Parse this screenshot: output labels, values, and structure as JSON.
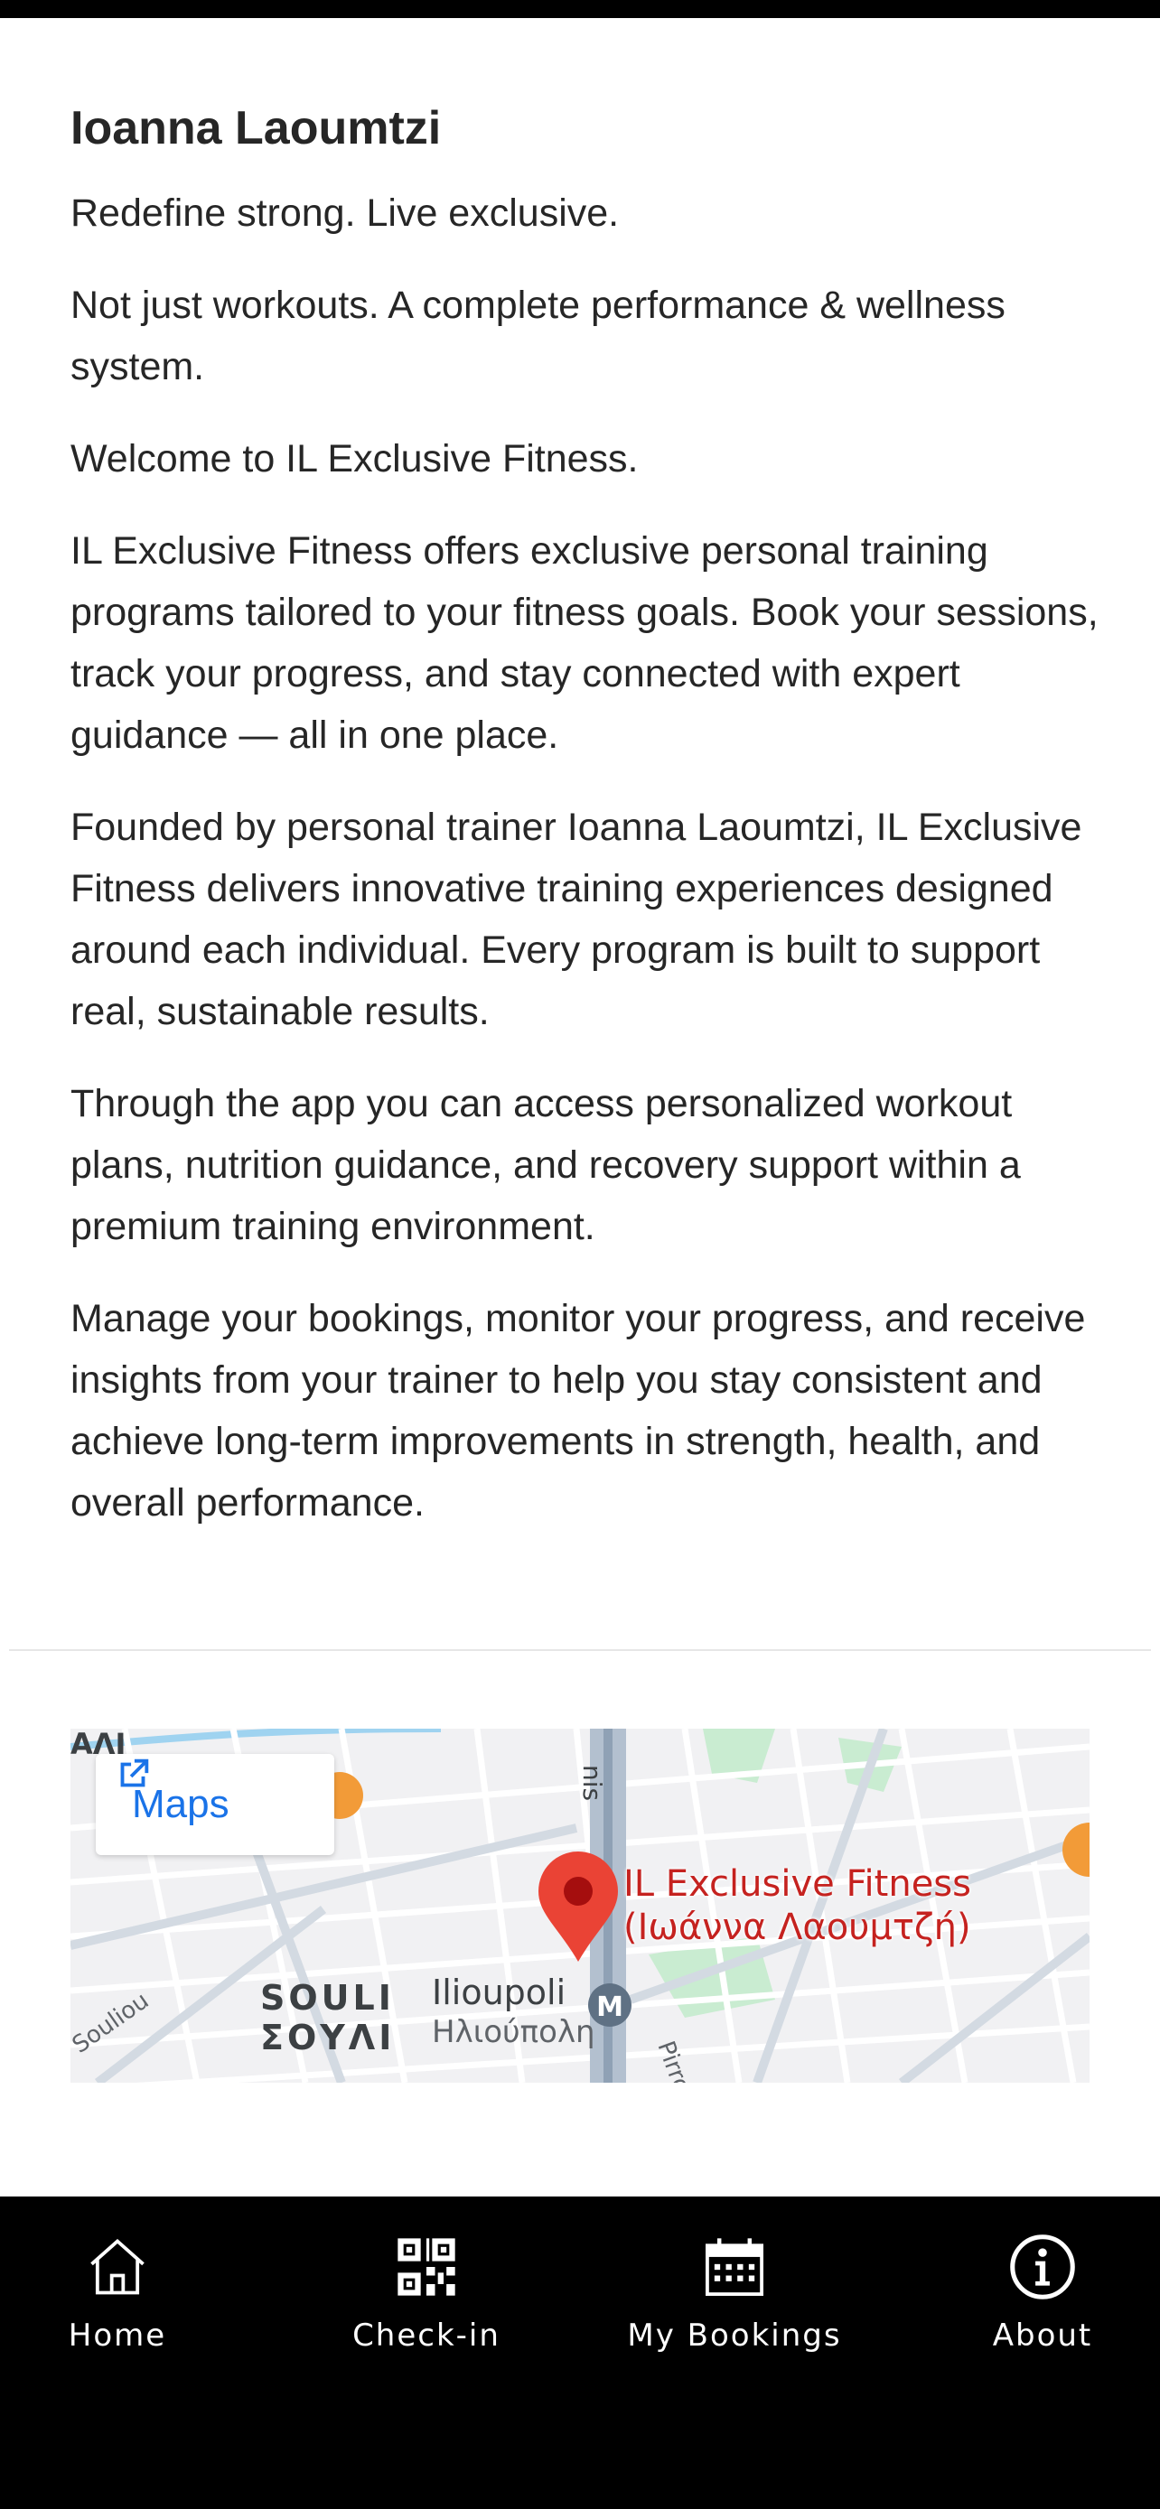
{
  "header": {
    "title": "Ioanna Laoumtzi"
  },
  "about": {
    "paragraphs": [
      "Redefine strong. Live exclusive.",
      "Not just workouts. A complete performance & wellness system.",
      "Welcome to IL Exclusive Fitness.",
      "IL Exclusive Fitness offers exclusive personal training programs tailored to your fitness goals. Book your sessions, track your progress, and stay connected with expert guidance — all in one place.",
      "Founded by personal trainer Ioanna Laoumtzi, IL Exclusive Fitness delivers innovative training experiences designed around each individual. Every program is built to support real, sustainable results.",
      "Through the app you can access personalized workout plans, nutrition guidance, and recovery support within a premium training environment.",
      "Manage your bookings, monitor your progress, and receive insights from your trainer to help you stay consistent and achieve long-term improvements in strength, health, and overall performance."
    ]
  },
  "map": {
    "maps_button_label": "Maps",
    "place_name_line1": "IL Exclusive Fitness",
    "place_name_line2": "(Ιωάννα Λαουμτζή)",
    "district_en": "SOULI",
    "district_gr": "ΣΟΥΛΙ",
    "station_en": "Ilioupoli",
    "station_gr": "Ηλιούπολη",
    "metro_badge": "M",
    "street_1": "Souliou",
    "street_2": "Pirro",
    "street_3": "nis",
    "top_left_fragment": "ΑΛΙ",
    "pin_color": "#ea4335",
    "place_label_color": "#c5221f",
    "link_color": "#1a73e8"
  },
  "nav": {
    "items": [
      {
        "label": "Home",
        "icon": "home-icon"
      },
      {
        "label": "Check-in",
        "icon": "qr-code-icon"
      },
      {
        "label": "My Bookings",
        "icon": "calendar-icon"
      },
      {
        "label": "About",
        "icon": "info-icon"
      }
    ]
  }
}
